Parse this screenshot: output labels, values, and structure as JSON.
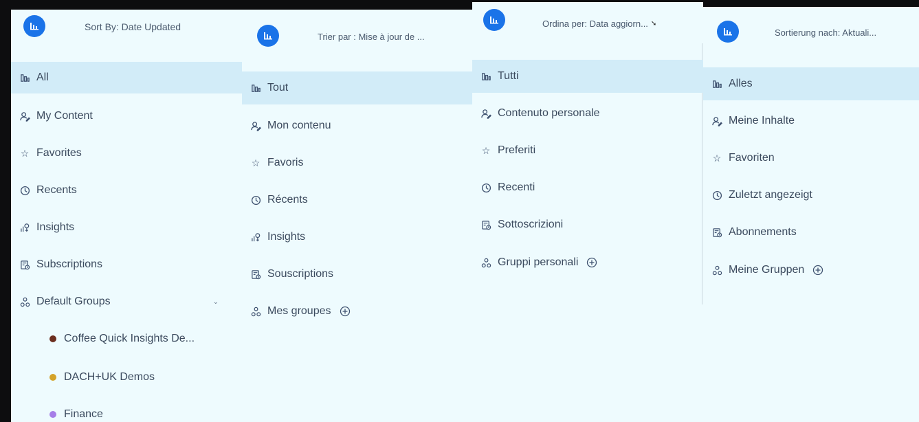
{
  "colors": {
    "accent": "#1a73e8",
    "panel_bg": "#eefbfe",
    "active_bg": "#d2ecf8",
    "dot_coffee": "#6b2e1f",
    "dot_dach": "#d4a32a",
    "dot_finance": "#a67ee8"
  },
  "en": {
    "sort_label": "Sort By: Date Updated",
    "items": [
      "All",
      "My Content",
      "Favorites",
      "Recents",
      "Insights",
      "Subscriptions",
      "Default Groups"
    ],
    "groups": [
      "Coffee Quick Insights De...",
      "DACH+UK Demos",
      "Finance"
    ]
  },
  "fr": {
    "sort_label": "Trier par : Mise à jour de ...",
    "items": [
      "Tout",
      "Mon contenu",
      "Favoris",
      "Récents",
      "Insights",
      "Souscriptions",
      "Mes groupes"
    ]
  },
  "it": {
    "sort_label": "Ordina per: Data aggiorn...",
    "items": [
      "Tutti",
      "Contenuto personale",
      "Preferiti",
      "Recenti",
      "Sottoscrizioni",
      "Gruppi personali"
    ]
  },
  "de": {
    "sort_label": "Sortierung nach: Aktuali...",
    "items": [
      "Alles",
      "Meine Inhalte",
      "Favoriten",
      "Zuletzt angezeigt",
      "Abonnements",
      "Meine Gruppen"
    ]
  },
  "icons": {
    "logo": "bar-chart-logo-icon",
    "all": "bar-chart-icon",
    "content": "user-edit-icon",
    "favorites": "star-icon",
    "recents": "clock-icon",
    "insights": "insights-icon",
    "subscriptions": "subscription-icon",
    "groups": "groups-icon",
    "add": "plus-circle-icon",
    "expand": "chevron-down-icon"
  }
}
